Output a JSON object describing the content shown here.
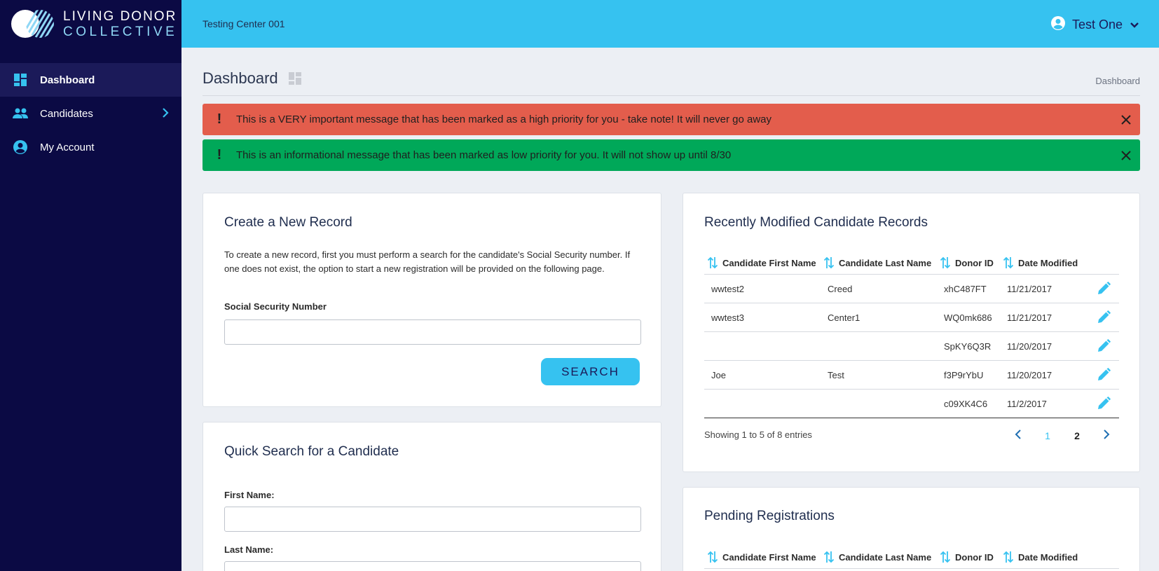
{
  "brand": {
    "line1": "LIVING DONOR",
    "line2": "COLLECTIVE"
  },
  "sidebar": {
    "items": [
      {
        "label": "Dashboard",
        "icon": "dashboard-icon",
        "active": true
      },
      {
        "label": "Candidates",
        "icon": "people-icon"
      },
      {
        "label": "My Account",
        "icon": "account-circle-icon"
      }
    ]
  },
  "topbar": {
    "center_name": "Testing Center 001",
    "user_name": "Test One"
  },
  "header": {
    "title": "Dashboard",
    "breadcrumb": "Dashboard"
  },
  "alerts": [
    {
      "text": "This is a VERY important message that has been marked as a high priority for you - take note! It will never go away",
      "color": "#e35d4c"
    },
    {
      "text": "This is an informational message that has been marked as low priority for you. It will not show up until 8/30",
      "color": "#00a859"
    }
  ],
  "create_record": {
    "title": "Create a New Record",
    "description": "To create a new record, first you must perform a search for the candidate's Social Security number. If one does not exist, the option to start a new registration will be provided on the following page.",
    "ssn_label": "Social Security Number",
    "ssn_value": "",
    "search_label": "SEARCH"
  },
  "quick_search": {
    "title": "Quick Search for a Candidate",
    "first_name_label": "First Name:",
    "last_name_label": "Last Name:"
  },
  "recent": {
    "title": "Recently Modified Candidate Records",
    "columns": [
      "Candidate First Name",
      "Candidate Last Name",
      "Donor ID",
      "Date Modified"
    ],
    "rows": [
      {
        "first": "wwtest2",
        "last": "Creed",
        "donor_id": "xhC487FT",
        "date": "11/21/2017"
      },
      {
        "first": "wwtest3",
        "last": "Center1",
        "donor_id": "WQ0mk686",
        "date": "11/21/2017"
      },
      {
        "first": "",
        "last": "",
        "donor_id": "SpKY6Q3R",
        "date": "11/20/2017"
      },
      {
        "first": "Joe",
        "last": "Test",
        "donor_id": "f3P9rYbU",
        "date": "11/20/2017"
      },
      {
        "first": "",
        "last": "",
        "donor_id": "c09XK4C6",
        "date": "11/2/2017"
      }
    ],
    "showing": "Showing 1 to 5 of 8 entries",
    "pages": [
      "1",
      "2"
    ]
  },
  "pending": {
    "title": "Pending Registrations",
    "columns": [
      "Candidate First Name",
      "Candidate Last Name",
      "Donor ID",
      "Date Modified"
    ]
  },
  "colors": {
    "sidebar": "#0b0a44",
    "accent": "#36c2f0",
    "danger": "#e35d4c",
    "success": "#00a859"
  }
}
